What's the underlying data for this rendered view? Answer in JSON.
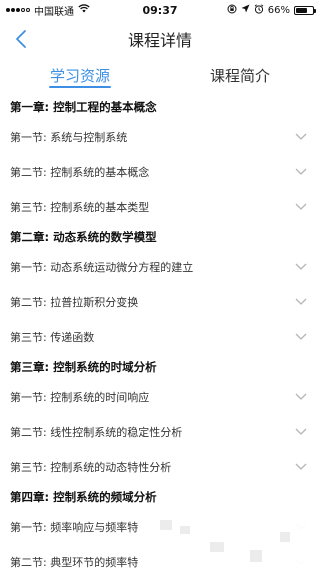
{
  "status_bar": {
    "carrier": "中国联通",
    "time": "09:37",
    "battery_pct": "66%",
    "battery_level": 0.66
  },
  "nav": {
    "title": "课程详情",
    "back_icon": "chevron-left-icon"
  },
  "tabs": [
    {
      "label": "学习资源",
      "active": true
    },
    {
      "label": "课程简介",
      "active": false
    }
  ],
  "chapters": [
    {
      "title": "第一章: 控制工程的基本概念",
      "sections": [
        "第一节: 系统与控制系统",
        "第二节: 控制系统的基本概念",
        "第三节: 控制系统的基本类型"
      ]
    },
    {
      "title": "第二章: 动态系统的数学模型",
      "sections": [
        "第一节: 动态系统运动微分方程的建立",
        "第二节: 拉普拉斯积分变换",
        "第三节: 传递函数"
      ]
    },
    {
      "title": "第三章: 控制系统的时域分析",
      "sections": [
        "第一节: 控制系统的时间响应",
        "第二节: 线性控制系统的稳定性分析",
        "第三节: 控制系统的动态特性分析"
      ]
    },
    {
      "title": "第四章: 控制系统的频域分析",
      "sections": [
        "第一节: 频率响应与频率特",
        "第二节: 典型环节的频率特"
      ]
    }
  ],
  "colors": {
    "accent": "#3d8fe6",
    "chevron": "#b5b5b5"
  }
}
